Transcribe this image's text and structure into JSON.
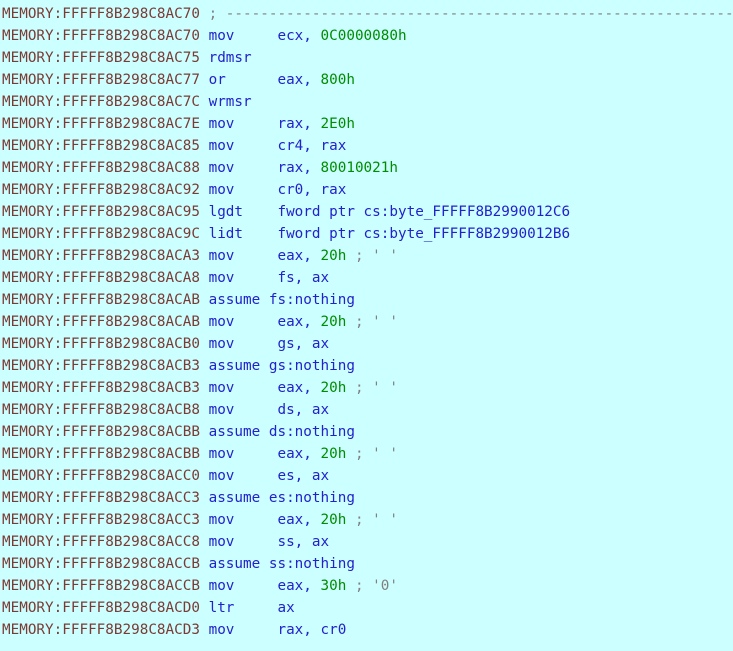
{
  "view": {
    "name": "IDA View-A disassembly",
    "segment": "MEMORY",
    "background_color": "#ccffff",
    "address_color": "#7b3b35",
    "mnemonic_color": "#2222cc",
    "immediate_color": "#008c00",
    "comment_color": "#808080"
  },
  "lines": [
    {
      "addr": "MEMORY:FFFFF8B298C8AC70",
      "mnemonic": "",
      "operands": "",
      "comment": "; ------------------------------------------------------------",
      "kind": "comment"
    },
    {
      "addr": "MEMORY:FFFFF8B298C8AC70",
      "mnemonic": "mov",
      "operands": "ecx, ",
      "immediate": "0C0000080h",
      "comment": "",
      "kind": "instruction"
    },
    {
      "addr": "MEMORY:FFFFF8B298C8AC75",
      "mnemonic": "rdmsr",
      "operands": "",
      "immediate": "",
      "comment": "",
      "kind": "instruction"
    },
    {
      "addr": "MEMORY:FFFFF8B298C8AC77",
      "mnemonic": "or",
      "operands": "eax, ",
      "immediate": "800h",
      "comment": "",
      "kind": "instruction"
    },
    {
      "addr": "MEMORY:FFFFF8B298C8AC7C",
      "mnemonic": "wrmsr",
      "operands": "",
      "immediate": "",
      "comment": "",
      "kind": "instruction"
    },
    {
      "addr": "MEMORY:FFFFF8B298C8AC7E",
      "mnemonic": "mov",
      "operands": "rax, ",
      "immediate": "2E0h",
      "comment": "",
      "kind": "instruction"
    },
    {
      "addr": "MEMORY:FFFFF8B298C8AC85",
      "mnemonic": "mov",
      "operands": "cr4, rax",
      "immediate": "",
      "comment": "",
      "kind": "instruction"
    },
    {
      "addr": "MEMORY:FFFFF8B298C8AC88",
      "mnemonic": "mov",
      "operands": "rax, ",
      "immediate": "80010021h",
      "comment": "",
      "kind": "instruction"
    },
    {
      "addr": "MEMORY:FFFFF8B298C8AC92",
      "mnemonic": "mov",
      "operands": "cr0, rax",
      "immediate": "",
      "comment": "",
      "kind": "instruction"
    },
    {
      "addr": "MEMORY:FFFFF8B298C8AC95",
      "mnemonic": "lgdt",
      "operands": "fword ptr cs:byte_FFFFF8B2990012C6",
      "immediate": "",
      "comment": "",
      "kind": "instruction"
    },
    {
      "addr": "MEMORY:FFFFF8B298C8AC9C",
      "mnemonic": "lidt",
      "operands": "fword ptr cs:byte_FFFFF8B2990012B6",
      "immediate": "",
      "comment": "",
      "kind": "instruction"
    },
    {
      "addr": "MEMORY:FFFFF8B298C8ACA3",
      "mnemonic": "mov",
      "operands": "eax, ",
      "immediate": "20h",
      "comment": "; ' '",
      "kind": "instruction"
    },
    {
      "addr": "MEMORY:FFFFF8B298C8ACA8",
      "mnemonic": "mov",
      "operands": "fs, ax",
      "immediate": "",
      "comment": "",
      "kind": "instruction"
    },
    {
      "addr": "MEMORY:FFFFF8B298C8ACAB",
      "mnemonic": "assume",
      "operands": "fs:nothing",
      "immediate": "",
      "comment": "",
      "kind": "assume"
    },
    {
      "addr": "MEMORY:FFFFF8B298C8ACAB",
      "mnemonic": "mov",
      "operands": "eax, ",
      "immediate": "20h",
      "comment": "; ' '",
      "kind": "instruction"
    },
    {
      "addr": "MEMORY:FFFFF8B298C8ACB0",
      "mnemonic": "mov",
      "operands": "gs, ax",
      "immediate": "",
      "comment": "",
      "kind": "instruction"
    },
    {
      "addr": "MEMORY:FFFFF8B298C8ACB3",
      "mnemonic": "assume",
      "operands": "gs:nothing",
      "immediate": "",
      "comment": "",
      "kind": "assume"
    },
    {
      "addr": "MEMORY:FFFFF8B298C8ACB3",
      "mnemonic": "mov",
      "operands": "eax, ",
      "immediate": "20h",
      "comment": "; ' '",
      "kind": "instruction"
    },
    {
      "addr": "MEMORY:FFFFF8B298C8ACB8",
      "mnemonic": "mov",
      "operands": "ds, ax",
      "immediate": "",
      "comment": "",
      "kind": "instruction"
    },
    {
      "addr": "MEMORY:FFFFF8B298C8ACBB",
      "mnemonic": "assume",
      "operands": "ds:nothing",
      "immediate": "",
      "comment": "",
      "kind": "assume"
    },
    {
      "addr": "MEMORY:FFFFF8B298C8ACBB",
      "mnemonic": "mov",
      "operands": "eax, ",
      "immediate": "20h",
      "comment": "; ' '",
      "kind": "instruction"
    },
    {
      "addr": "MEMORY:FFFFF8B298C8ACC0",
      "mnemonic": "mov",
      "operands": "es, ax",
      "immediate": "",
      "comment": "",
      "kind": "instruction"
    },
    {
      "addr": "MEMORY:FFFFF8B298C8ACC3",
      "mnemonic": "assume",
      "operands": "es:nothing",
      "immediate": "",
      "comment": "",
      "kind": "assume"
    },
    {
      "addr": "MEMORY:FFFFF8B298C8ACC3",
      "mnemonic": "mov",
      "operands": "eax, ",
      "immediate": "20h",
      "comment": "; ' '",
      "kind": "instruction"
    },
    {
      "addr": "MEMORY:FFFFF8B298C8ACC8",
      "mnemonic": "mov",
      "operands": "ss, ax",
      "immediate": "",
      "comment": "",
      "kind": "instruction"
    },
    {
      "addr": "MEMORY:FFFFF8B298C8ACCB",
      "mnemonic": "assume",
      "operands": "ss:nothing",
      "immediate": "",
      "comment": "",
      "kind": "assume"
    },
    {
      "addr": "MEMORY:FFFFF8B298C8ACCB",
      "mnemonic": "mov",
      "operands": "eax, ",
      "immediate": "30h",
      "comment": "; '0'",
      "kind": "instruction"
    },
    {
      "addr": "MEMORY:FFFFF8B298C8ACD0",
      "mnemonic": "ltr",
      "operands": "ax",
      "immediate": "",
      "comment": "",
      "kind": "instruction"
    },
    {
      "addr": "MEMORY:FFFFF8B298C8ACD3",
      "mnemonic": "mov",
      "operands": "rax, cr0",
      "immediate": "",
      "comment": "",
      "kind": "instruction"
    }
  ]
}
